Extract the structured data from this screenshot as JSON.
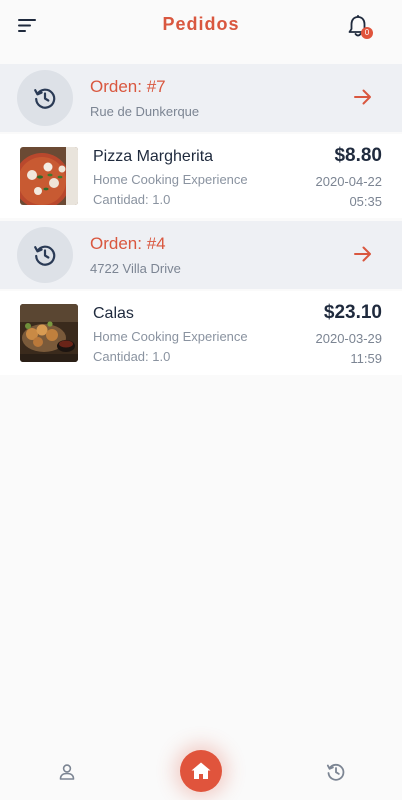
{
  "header": {
    "title": "Pedidos",
    "notification_count": "0",
    "menu_icon": "filter-menu-icon",
    "bell_icon": "bell-icon"
  },
  "orders": [
    {
      "title": "Orden: #7",
      "address": "Rue de Dunkerque",
      "status_icon": "history-clock-icon",
      "item": {
        "name": "Pizza Margherita",
        "restaurant": "Home Cooking Experience",
        "quantity": "Cantidad: 1.0",
        "price": "$8.80",
        "date": "2020-04-22",
        "time": "05:35"
      }
    },
    {
      "title": "Orden: #4",
      "address": "4722 Villa Drive",
      "status_icon": "history-clock-icon",
      "item": {
        "name": "Calas",
        "restaurant": "Home Cooking Experience",
        "quantity": "Cantidad: 1.0",
        "price": "$23.10",
        "date": "2020-03-29",
        "time": "11:59"
      }
    }
  ],
  "bottom_nav": {
    "left_icon": "user-icon",
    "center_icon": "home-icon",
    "right_icon": "history-icon"
  },
  "colors": {
    "accent": "#d9573f",
    "badge": "#e0543c",
    "text_dark": "#1f2a3d",
    "text_muted": "#8a93a0",
    "order_bg": "#eef0f4"
  }
}
